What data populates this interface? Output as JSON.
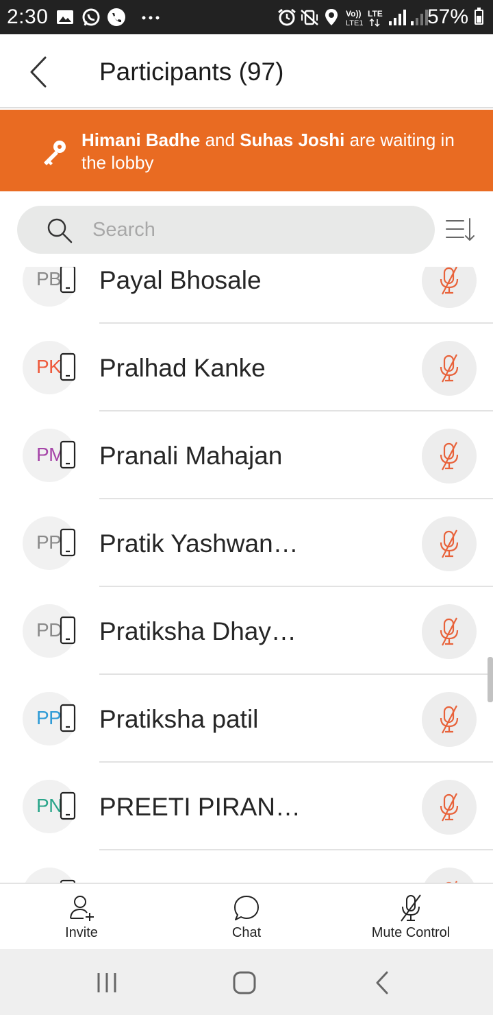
{
  "status_bar": {
    "time": "2:30",
    "battery": "57%"
  },
  "header": {
    "title": "Participants (97)"
  },
  "lobby": {
    "name1": "Himani Badhe",
    "connector": " and ",
    "name2": "Suhas Joshi",
    "suffix": " are waiting in the lobby"
  },
  "search": {
    "placeholder": "Search"
  },
  "participants": [
    {
      "initials": "PB",
      "name": "Payal Bhosale",
      "color": "#8a8a8a"
    },
    {
      "initials": "PK",
      "name": "Pralhad Kanke",
      "color": "#ee5a3c"
    },
    {
      "initials": "PM",
      "name": "Pranali Mahajan",
      "color": "#a545a8"
    },
    {
      "initials": "PP",
      "name": "Pratik Yashwan…",
      "color": "#8a8a8a"
    },
    {
      "initials": "PD",
      "name": "Pratiksha Dhay…",
      "color": "#8a8a8a"
    },
    {
      "initials": "PP",
      "name": "Pratiksha patil",
      "color": "#2f9bd6"
    },
    {
      "initials": "PN",
      "name": "PREETI PIRAN…",
      "color": "#2aa58a"
    },
    {
      "initials": "",
      "name": "",
      "color": "#8a8a8a"
    }
  ],
  "toolbar": {
    "invite": "Invite",
    "chat": "Chat",
    "mute_control": "Mute Control"
  },
  "colors": {
    "accent": "#e96b22",
    "muted_mic": "#e8623a"
  }
}
